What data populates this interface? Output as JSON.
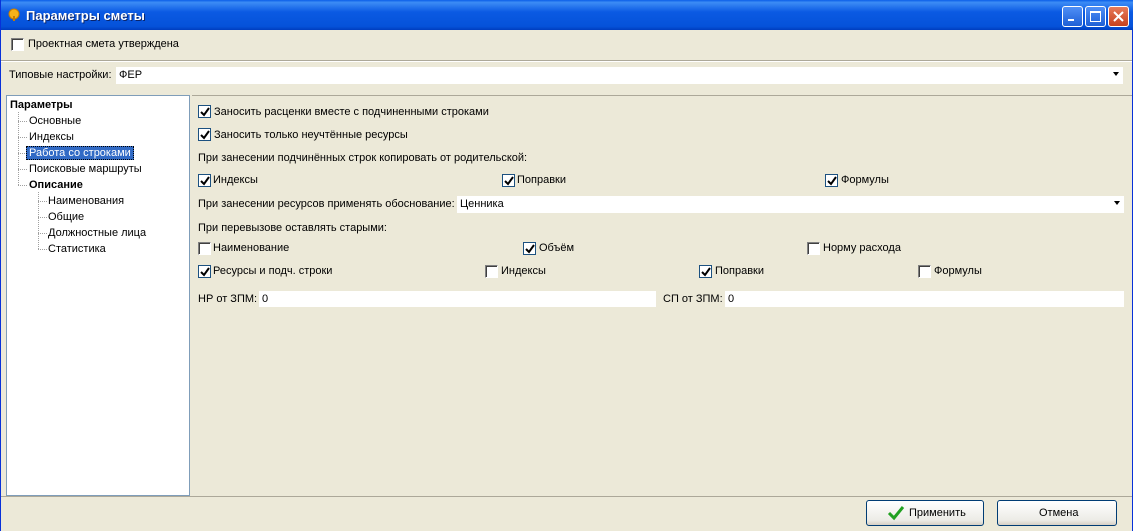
{
  "window": {
    "title": "Параметры сметы",
    "icon": "app-logo-icon",
    "controls": [
      "minimize-icon",
      "maximize-icon",
      "close-icon"
    ]
  },
  "approved": {
    "label": "Проектная смета утверждена",
    "checked": false
  },
  "typical": {
    "label": "Типовые настройки:",
    "value": "ФЕР"
  },
  "tree": {
    "root": "Параметры",
    "items": [
      "Основные",
      "Индексы",
      "Работа со строками",
      "Поисковые маршруты"
    ],
    "group": "Описание",
    "subitems": [
      "Наименования",
      "Общие",
      "Должностные лица",
      "Статистика"
    ],
    "selected": "Работа со строками"
  },
  "options": {
    "with_children": {
      "label": "Заносить расценки вместе с подчиненными строками",
      "checked": true
    },
    "only_unaccounted": {
      "label": "Заносить только неучтённые ресурсы",
      "checked": true
    },
    "copy_heading": "При занесении подчинённых строк копировать от родительской:",
    "copy": [
      {
        "label": "Индексы",
        "checked": true
      },
      {
        "label": "Поправки",
        "checked": true
      },
      {
        "label": "Формулы",
        "checked": true
      }
    ],
    "justification_label": "При занесении ресурсов применять обоснование:",
    "justification_value": "Ценника",
    "keep_heading": "При перевызове оставлять старыми:",
    "keep_row1": [
      {
        "label": "Наименование",
        "checked": false
      },
      {
        "label": "Объём",
        "checked": true
      },
      {
        "label": "Норму расхода",
        "checked": false
      }
    ],
    "keep_row2": [
      {
        "label": "Ресурсы и подч. строки",
        "checked": true
      },
      {
        "label": "Индексы",
        "checked": false
      },
      {
        "label": "Поправки",
        "checked": true
      },
      {
        "label": "Формулы",
        "checked": false
      }
    ],
    "np_label": "НР от ЗПМ:",
    "np_value": "0",
    "sp_label": "СП от ЗПМ:",
    "sp_value": "0"
  },
  "buttons": {
    "apply": "Применить",
    "cancel": "Отмена"
  },
  "colors": {
    "titlebar": "#0554d9",
    "selection": "#316ac5",
    "face": "#ece9d8",
    "check": "#21a121"
  }
}
